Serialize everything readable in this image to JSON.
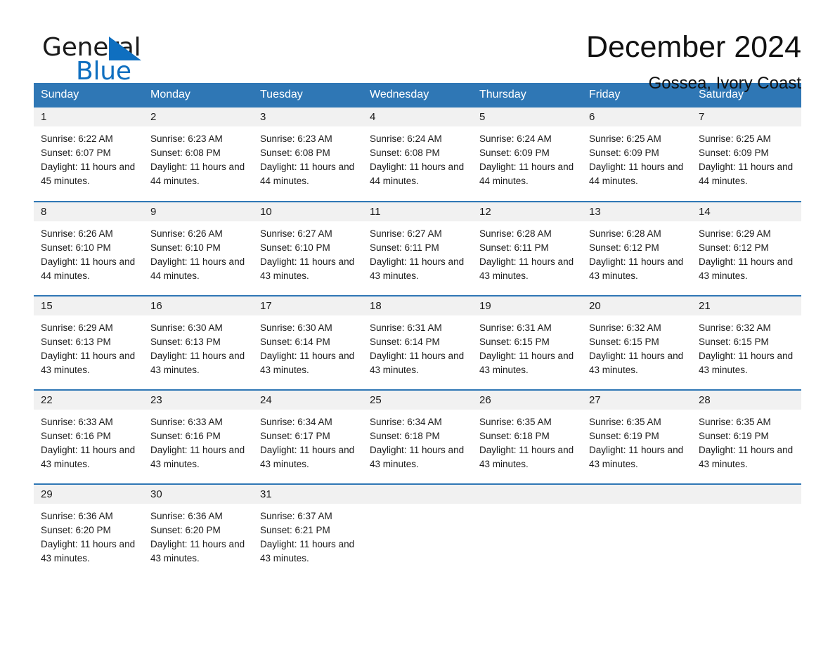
{
  "brand": {
    "name_part1": "General",
    "name_part2": "Blue",
    "logo_icon": "triangle-flag-icon",
    "accent_color": "#0f6fc0"
  },
  "header": {
    "month_title": "December 2024",
    "location": "Gossea, Ivory Coast"
  },
  "theme": {
    "header_bg": "#2f77b5",
    "daynum_bg": "#f1f1f1",
    "rule_color": "#2f77b5",
    "text_color": "#1b1b1b"
  },
  "weekday_headers": [
    "Sunday",
    "Monday",
    "Tuesday",
    "Wednesday",
    "Thursday",
    "Friday",
    "Saturday"
  ],
  "weeks": [
    [
      {
        "day": "1",
        "sunrise": "Sunrise: 6:22 AM",
        "sunset": "Sunset: 6:07 PM",
        "daylight": "Daylight: 11 hours and 45 minutes."
      },
      {
        "day": "2",
        "sunrise": "Sunrise: 6:23 AM",
        "sunset": "Sunset: 6:08 PM",
        "daylight": "Daylight: 11 hours and 44 minutes."
      },
      {
        "day": "3",
        "sunrise": "Sunrise: 6:23 AM",
        "sunset": "Sunset: 6:08 PM",
        "daylight": "Daylight: 11 hours and 44 minutes."
      },
      {
        "day": "4",
        "sunrise": "Sunrise: 6:24 AM",
        "sunset": "Sunset: 6:08 PM",
        "daylight": "Daylight: 11 hours and 44 minutes."
      },
      {
        "day": "5",
        "sunrise": "Sunrise: 6:24 AM",
        "sunset": "Sunset: 6:09 PM",
        "daylight": "Daylight: 11 hours and 44 minutes."
      },
      {
        "day": "6",
        "sunrise": "Sunrise: 6:25 AM",
        "sunset": "Sunset: 6:09 PM",
        "daylight": "Daylight: 11 hours and 44 minutes."
      },
      {
        "day": "7",
        "sunrise": "Sunrise: 6:25 AM",
        "sunset": "Sunset: 6:09 PM",
        "daylight": "Daylight: 11 hours and 44 minutes."
      }
    ],
    [
      {
        "day": "8",
        "sunrise": "Sunrise: 6:26 AM",
        "sunset": "Sunset: 6:10 PM",
        "daylight": "Daylight: 11 hours and 44 minutes."
      },
      {
        "day": "9",
        "sunrise": "Sunrise: 6:26 AM",
        "sunset": "Sunset: 6:10 PM",
        "daylight": "Daylight: 11 hours and 44 minutes."
      },
      {
        "day": "10",
        "sunrise": "Sunrise: 6:27 AM",
        "sunset": "Sunset: 6:10 PM",
        "daylight": "Daylight: 11 hours and 43 minutes."
      },
      {
        "day": "11",
        "sunrise": "Sunrise: 6:27 AM",
        "sunset": "Sunset: 6:11 PM",
        "daylight": "Daylight: 11 hours and 43 minutes."
      },
      {
        "day": "12",
        "sunrise": "Sunrise: 6:28 AM",
        "sunset": "Sunset: 6:11 PM",
        "daylight": "Daylight: 11 hours and 43 minutes."
      },
      {
        "day": "13",
        "sunrise": "Sunrise: 6:28 AM",
        "sunset": "Sunset: 6:12 PM",
        "daylight": "Daylight: 11 hours and 43 minutes."
      },
      {
        "day": "14",
        "sunrise": "Sunrise: 6:29 AM",
        "sunset": "Sunset: 6:12 PM",
        "daylight": "Daylight: 11 hours and 43 minutes."
      }
    ],
    [
      {
        "day": "15",
        "sunrise": "Sunrise: 6:29 AM",
        "sunset": "Sunset: 6:13 PM",
        "daylight": "Daylight: 11 hours and 43 minutes."
      },
      {
        "day": "16",
        "sunrise": "Sunrise: 6:30 AM",
        "sunset": "Sunset: 6:13 PM",
        "daylight": "Daylight: 11 hours and 43 minutes."
      },
      {
        "day": "17",
        "sunrise": "Sunrise: 6:30 AM",
        "sunset": "Sunset: 6:14 PM",
        "daylight": "Daylight: 11 hours and 43 minutes."
      },
      {
        "day": "18",
        "sunrise": "Sunrise: 6:31 AM",
        "sunset": "Sunset: 6:14 PM",
        "daylight": "Daylight: 11 hours and 43 minutes."
      },
      {
        "day": "19",
        "sunrise": "Sunrise: 6:31 AM",
        "sunset": "Sunset: 6:15 PM",
        "daylight": "Daylight: 11 hours and 43 minutes."
      },
      {
        "day": "20",
        "sunrise": "Sunrise: 6:32 AM",
        "sunset": "Sunset: 6:15 PM",
        "daylight": "Daylight: 11 hours and 43 minutes."
      },
      {
        "day": "21",
        "sunrise": "Sunrise: 6:32 AM",
        "sunset": "Sunset: 6:15 PM",
        "daylight": "Daylight: 11 hours and 43 minutes."
      }
    ],
    [
      {
        "day": "22",
        "sunrise": "Sunrise: 6:33 AM",
        "sunset": "Sunset: 6:16 PM",
        "daylight": "Daylight: 11 hours and 43 minutes."
      },
      {
        "day": "23",
        "sunrise": "Sunrise: 6:33 AM",
        "sunset": "Sunset: 6:16 PM",
        "daylight": "Daylight: 11 hours and 43 minutes."
      },
      {
        "day": "24",
        "sunrise": "Sunrise: 6:34 AM",
        "sunset": "Sunset: 6:17 PM",
        "daylight": "Daylight: 11 hours and 43 minutes."
      },
      {
        "day": "25",
        "sunrise": "Sunrise: 6:34 AM",
        "sunset": "Sunset: 6:18 PM",
        "daylight": "Daylight: 11 hours and 43 minutes."
      },
      {
        "day": "26",
        "sunrise": "Sunrise: 6:35 AM",
        "sunset": "Sunset: 6:18 PM",
        "daylight": "Daylight: 11 hours and 43 minutes."
      },
      {
        "day": "27",
        "sunrise": "Sunrise: 6:35 AM",
        "sunset": "Sunset: 6:19 PM",
        "daylight": "Daylight: 11 hours and 43 minutes."
      },
      {
        "day": "28",
        "sunrise": "Sunrise: 6:35 AM",
        "sunset": "Sunset: 6:19 PM",
        "daylight": "Daylight: 11 hours and 43 minutes."
      }
    ],
    [
      {
        "day": "29",
        "sunrise": "Sunrise: 6:36 AM",
        "sunset": "Sunset: 6:20 PM",
        "daylight": "Daylight: 11 hours and 43 minutes."
      },
      {
        "day": "30",
        "sunrise": "Sunrise: 6:36 AM",
        "sunset": "Sunset: 6:20 PM",
        "daylight": "Daylight: 11 hours and 43 minutes."
      },
      {
        "day": "31",
        "sunrise": "Sunrise: 6:37 AM",
        "sunset": "Sunset: 6:21 PM",
        "daylight": "Daylight: 11 hours and 43 minutes."
      },
      {
        "day": "",
        "sunrise": "",
        "sunset": "",
        "daylight": ""
      },
      {
        "day": "",
        "sunrise": "",
        "sunset": "",
        "daylight": ""
      },
      {
        "day": "",
        "sunrise": "",
        "sunset": "",
        "daylight": ""
      },
      {
        "day": "",
        "sunrise": "",
        "sunset": "",
        "daylight": ""
      }
    ]
  ]
}
